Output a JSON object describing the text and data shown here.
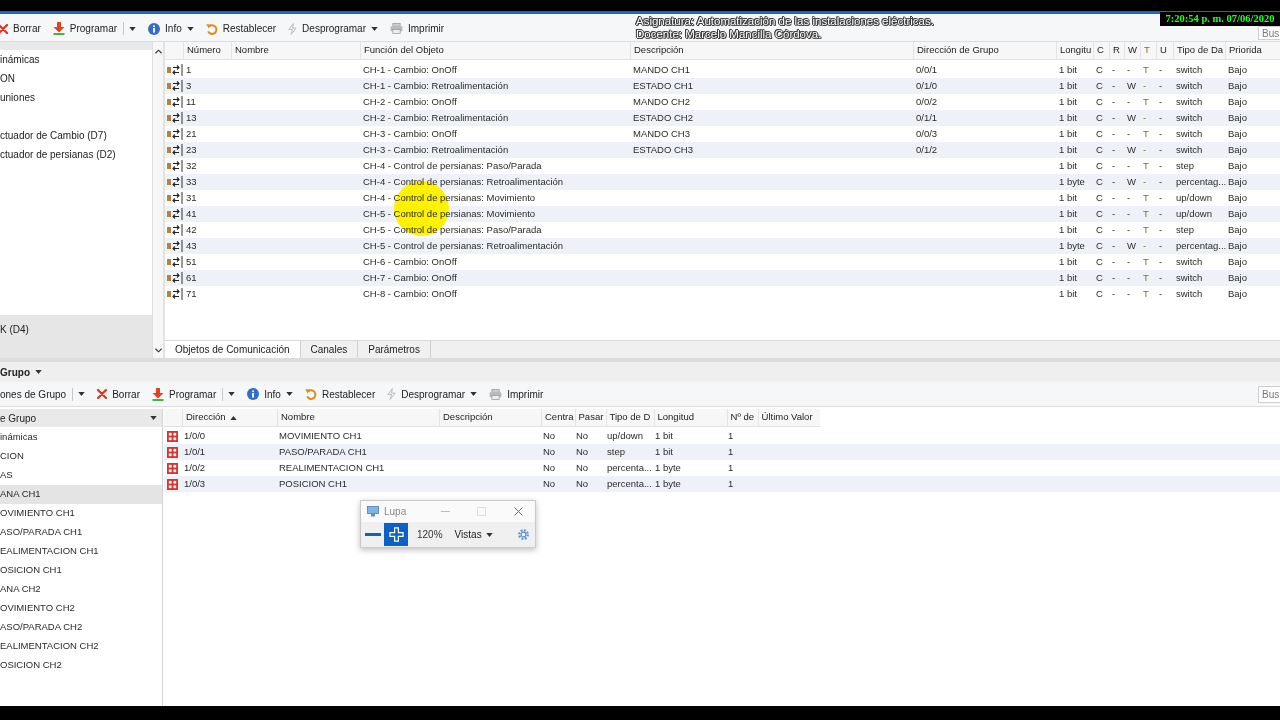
{
  "clock": "7:20:54 p. m. 07/06/2020",
  "caption": {
    "lines": [
      "Asignatura: Automatización de las instalaciones eléctricas.",
      "Docente: Marcelo Mancilla Córdova."
    ]
  },
  "toolbar": {
    "items": [
      {
        "kind": "delete",
        "label": "Borrar",
        "dropdown": false,
        "split": false
      },
      {
        "kind": "program",
        "label": "Programar",
        "dropdown": false,
        "split": true
      },
      {
        "kind": "info",
        "label": "Info",
        "dropdown": true,
        "split": false
      },
      {
        "kind": "reset",
        "label": "Restablecer",
        "dropdown": false,
        "split": false
      },
      {
        "kind": "unprogram",
        "label": "Desprogramar",
        "dropdown": true,
        "split": false
      },
      {
        "kind": "print",
        "label": "Imprimir",
        "dropdown": false,
        "split": false
      }
    ],
    "search": {
      "placeholder": "Bus"
    }
  },
  "object_tree": {
    "groups": [
      [
        {
          "label": "inámicas",
          "selected": false
        },
        {
          "label": "ON",
          "selected": false
        },
        {
          "label": "uniones",
          "selected": false
        }
      ],
      [
        {
          "label": "ctuador de Cambio (D7)",
          "selected": false
        },
        {
          "label": "ctuador de persianas (D2)",
          "selected": false
        }
      ],
      [
        {
          "label": "K (D4)",
          "selected": true
        }
      ]
    ]
  },
  "objects_table": {
    "columns": [
      "Número",
      "Nombre",
      "Función del Objeto",
      "Descripción",
      "Dirección de Grupo",
      "Longitu",
      "C",
      "R",
      "W",
      "T",
      "U",
      "Tipo de Da",
      "Priorida"
    ],
    "rows": [
      {
        "number": "1",
        "function": "CH-1 - Cambio: OnOff",
        "description": "MANDO CH1",
        "group_address": "0/0/1",
        "length": "1 bit",
        "c": "C",
        "r": "-",
        "w": "-",
        "t": "T",
        "u": "-",
        "type": "switch",
        "priority": "Bajo"
      },
      {
        "number": "3",
        "function": "CH-1 - Cambio: Retroalimentación",
        "description": "ESTADO CH1",
        "group_address": "0/1/0",
        "length": "1 bit",
        "c": "C",
        "r": "-",
        "w": "W",
        "t": "-",
        "u": "-",
        "type": "switch",
        "priority": "Bajo"
      },
      {
        "number": "11",
        "function": "CH-2 - Cambio: OnOff",
        "description": "MANDO CH2",
        "group_address": "0/0/2",
        "length": "1 bit",
        "c": "C",
        "r": "-",
        "w": "-",
        "t": "T",
        "u": "-",
        "type": "switch",
        "priority": "Bajo"
      },
      {
        "number": "13",
        "function": "CH-2 - Cambio: Retroalimentación",
        "description": "ESTADO CH2",
        "group_address": "0/1/1",
        "length": "1 bit",
        "c": "C",
        "r": "-",
        "w": "W",
        "t": "-",
        "u": "-",
        "type": "switch",
        "priority": "Bajo"
      },
      {
        "number": "21",
        "function": "CH-3 - Cambio: OnOff",
        "description": "MANDO CH3",
        "group_address": "0/0/3",
        "length": "1 bit",
        "c": "C",
        "r": "-",
        "w": "-",
        "t": "T",
        "u": "-",
        "type": "switch",
        "priority": "Bajo"
      },
      {
        "number": "23",
        "function": "CH-3 - Cambio: Retroalimentación",
        "description": "ESTADO CH3",
        "group_address": "0/1/2",
        "length": "1 bit",
        "c": "C",
        "r": "-",
        "w": "W",
        "t": "-",
        "u": "-",
        "type": "switch",
        "priority": "Bajo"
      },
      {
        "number": "32",
        "function": "CH-4 - Control de persianas: Paso/Parada",
        "length": "1 bit",
        "c": "C",
        "r": "-",
        "w": "-",
        "t": "T",
        "u": "-",
        "type": "step",
        "priority": "Bajo"
      },
      {
        "number": "33",
        "function": "CH-4 - Control de persianas: Retroalimentación",
        "length": "1 byte",
        "c": "C",
        "r": "-",
        "w": "W",
        "t": "-",
        "u": "-",
        "type": "percentag...",
        "priority": "Bajo"
      },
      {
        "number": "31",
        "function": "CH-4 - Control de persianas: Movimiento",
        "length": "1 bit",
        "c": "C",
        "r": "-",
        "w": "-",
        "t": "T",
        "u": "-",
        "type": "up/down",
        "priority": "Bajo"
      },
      {
        "number": "41",
        "function": "CH-5 - Control de persianas: Movimiento",
        "length": "1 bit",
        "c": "C",
        "r": "-",
        "w": "-",
        "t": "T",
        "u": "-",
        "type": "up/down",
        "priority": "Bajo"
      },
      {
        "number": "42",
        "function": "CH-5 - Control de persianas: Paso/Parada",
        "length": "1 bit",
        "c": "C",
        "r": "-",
        "w": "-",
        "t": "T",
        "u": "-",
        "type": "step",
        "priority": "Bajo"
      },
      {
        "number": "43",
        "function": "CH-5 - Control de persianas: Retroalimentación",
        "length": "1 byte",
        "c": "C",
        "r": "-",
        "w": "W",
        "t": "-",
        "u": "-",
        "type": "percentag...",
        "priority": "Bajo"
      },
      {
        "number": "51",
        "function": "CH-6 - Cambio: OnOff",
        "length": "1 bit",
        "c": "C",
        "r": "-",
        "w": "-",
        "t": "T",
        "u": "-",
        "type": "switch",
        "priority": "Bajo"
      },
      {
        "number": "61",
        "function": "CH-7 - Cambio: OnOff",
        "length": "1 bit",
        "c": "C",
        "r": "-",
        "w": "-",
        "t": "T",
        "u": "-",
        "type": "switch",
        "priority": "Bajo"
      },
      {
        "number": "71",
        "function": "CH-8 - Cambio: OnOff",
        "length": "1 bit",
        "c": "C",
        "r": "-",
        "w": "-",
        "t": "T",
        "u": "-",
        "type": "switch",
        "priority": "Bajo"
      }
    ]
  },
  "tabs": [
    {
      "label": "Objetos de Comunicación",
      "selected": true
    },
    {
      "label": "Canales",
      "selected": false
    },
    {
      "label": "Parámetros",
      "selected": false
    }
  ],
  "group_panel": {
    "title": "Grupo",
    "toolbar": {
      "items": [
        {
          "kind": "text",
          "label": "ones de Grupo",
          "dropdown": false,
          "split": true
        },
        {
          "kind": "delete",
          "label": "Borrar",
          "dropdown": false,
          "split": false
        },
        {
          "kind": "program",
          "label": "Programar",
          "dropdown": false,
          "split": true
        },
        {
          "kind": "info",
          "label": "Info",
          "dropdown": true,
          "split": false
        },
        {
          "kind": "reset",
          "label": "Restablecer",
          "dropdown": false,
          "split": false
        },
        {
          "kind": "unprogram",
          "label": "Desprogramar",
          "dropdown": true,
          "split": false
        },
        {
          "kind": "print",
          "label": "Imprimir",
          "dropdown": false,
          "split": false
        }
      ],
      "search": {
        "placeholder": "Bus"
      }
    },
    "tree": {
      "header": "e Grupo",
      "items": [
        {
          "label": "inámicas",
          "selected": false
        },
        {
          "label": "CION",
          "selected": false
        },
        {
          "label": "AS",
          "selected": false
        },
        {
          "label": "ANA CH1",
          "selected": true
        },
        {
          "label": "OVIMIENTO CH1",
          "selected": false
        },
        {
          "label": "ASO/PARADA CH1",
          "selected": false
        },
        {
          "label": "EALIMENTACION CH1",
          "selected": false
        },
        {
          "label": "OSICION CH1",
          "selected": false
        },
        {
          "label": "ANA CH2",
          "selected": false
        },
        {
          "label": "OVIMIENTO CH2",
          "selected": false
        },
        {
          "label": "ASO/PARADA CH2",
          "selected": false
        },
        {
          "label": "EALIMENTACION CH2",
          "selected": false
        },
        {
          "label": "OSICION CH2",
          "selected": false
        }
      ]
    },
    "table": {
      "columns": [
        {
          "label": "Dirección",
          "sorted": true
        },
        {
          "label": "Nombre",
          "sorted": false
        },
        {
          "label": "Descripción",
          "sorted": false
        },
        {
          "label": "Centra",
          "sorted": false
        },
        {
          "label": "Pasar",
          "sorted": false
        },
        {
          "label": "Tipo de D",
          "sorted": false
        },
        {
          "label": "Longitud",
          "sorted": false
        },
        {
          "label": "Nº de",
          "sorted": false
        },
        {
          "label": "Último Valor",
          "sorted": false
        }
      ],
      "rows": [
        {
          "address": "1/0/0",
          "name": "MOVIMIENTO CH1",
          "central": "No",
          "pass_through": "No",
          "type": "up/down",
          "length": "1 bit",
          "count": "1"
        },
        {
          "address": "1/0/1",
          "name": "PASO/PARADA CH1",
          "central": "No",
          "pass_through": "No",
          "type": "step",
          "length": "1 bit",
          "count": "1"
        },
        {
          "address": "1/0/2",
          "name": "REALIMENTACION CH1",
          "central": "No",
          "pass_through": "No",
          "type": "percenta...",
          "length": "1 byte",
          "count": "1"
        },
        {
          "address": "1/0/3",
          "name": "POSICION CH1",
          "central": "No",
          "pass_through": "No",
          "type": "percenta...",
          "length": "1 byte",
          "count": "1"
        }
      ]
    }
  },
  "magnifier": {
    "title": "Lupa",
    "zoom": "120%",
    "views": "Vistas"
  }
}
